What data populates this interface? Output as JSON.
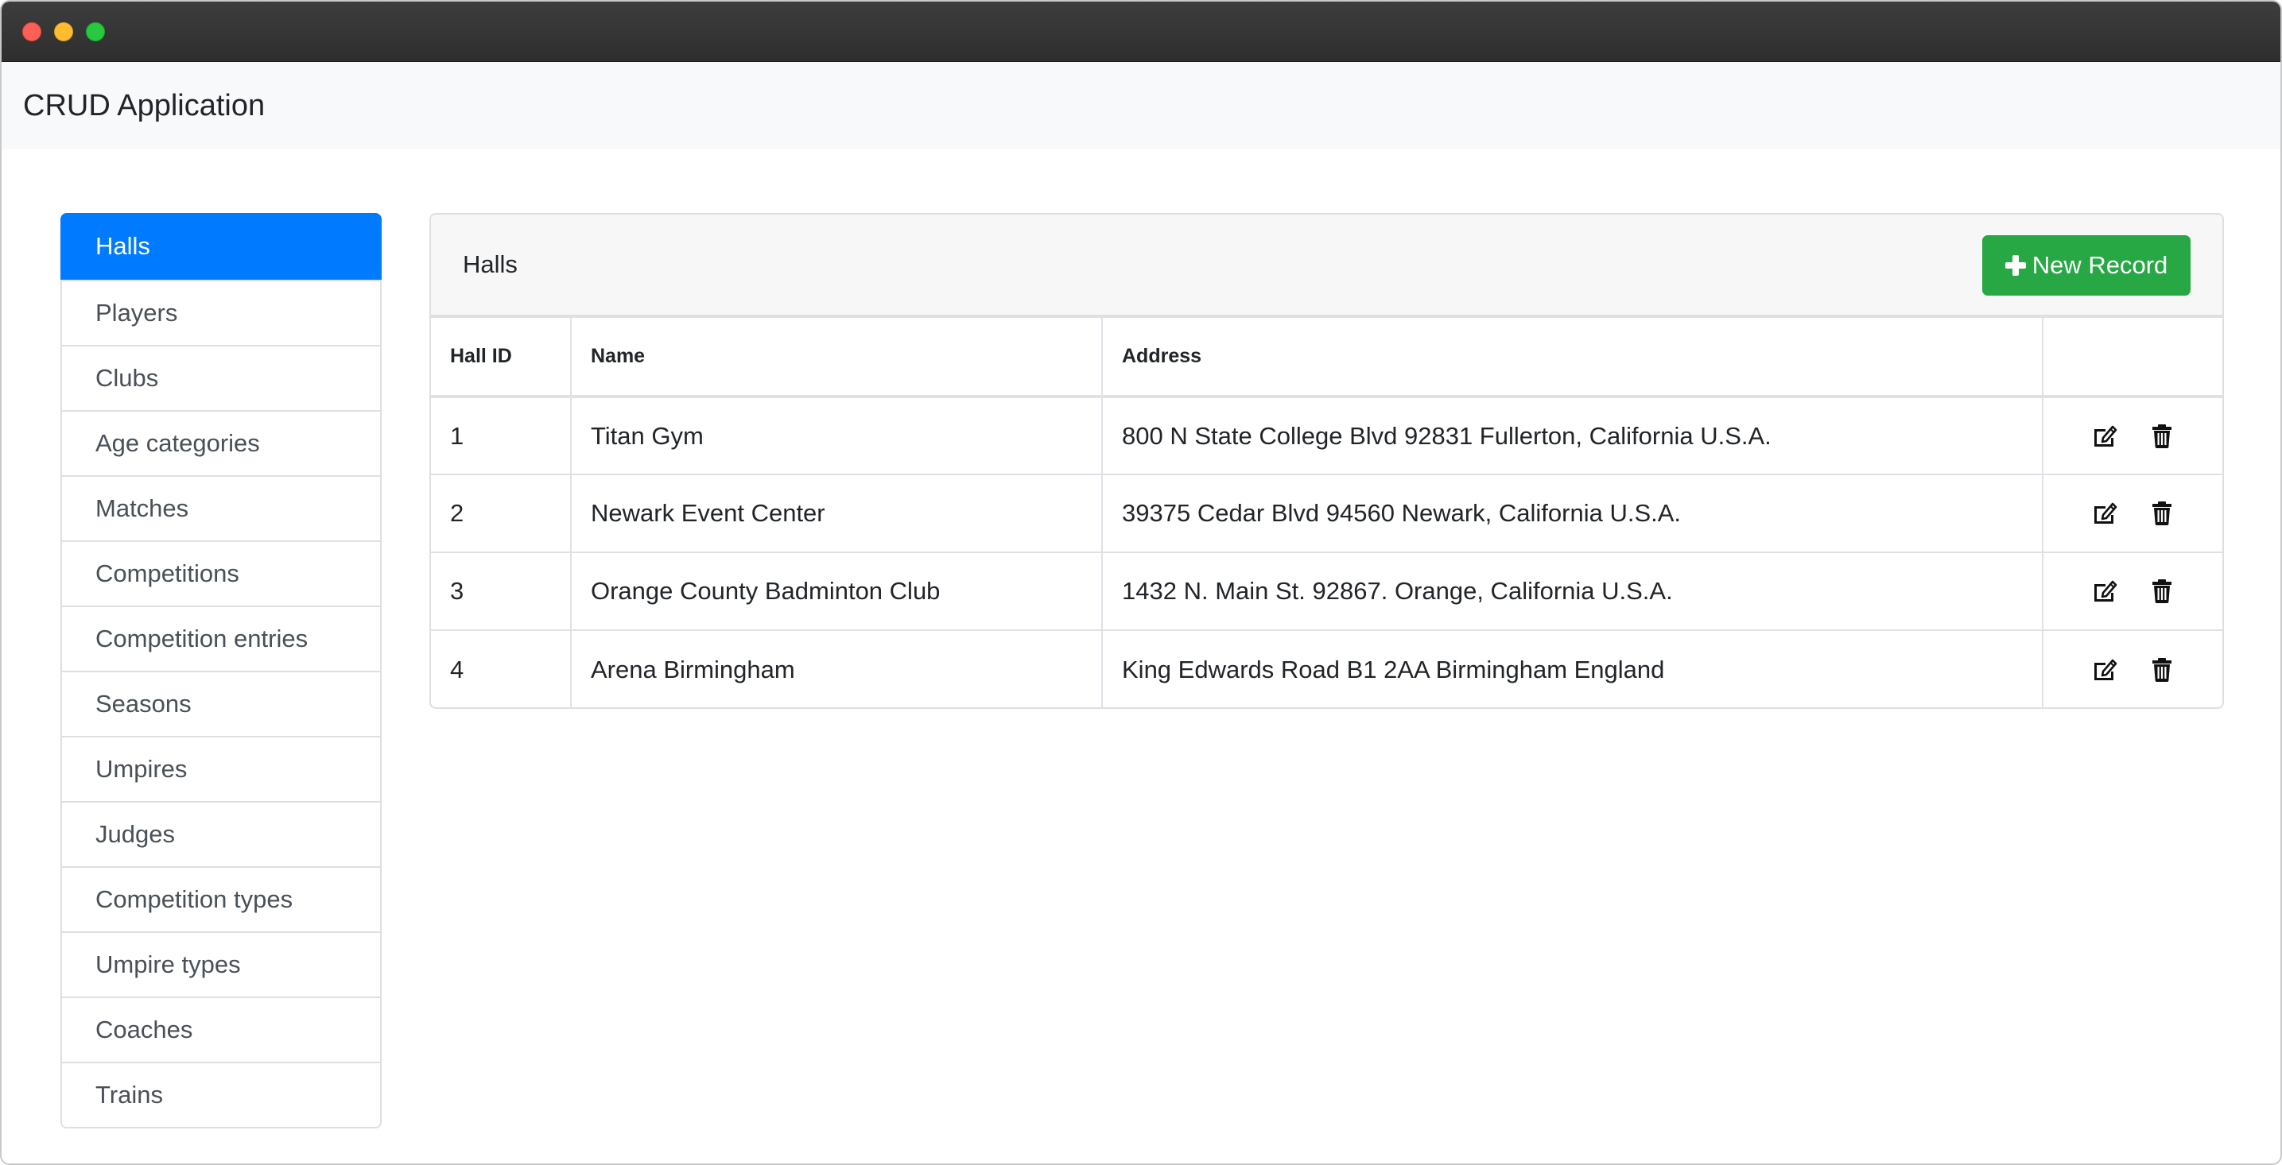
{
  "app": {
    "title": "CRUD Application"
  },
  "sidebar": {
    "items": [
      {
        "label": "Halls",
        "active": true
      },
      {
        "label": "Players"
      },
      {
        "label": "Clubs"
      },
      {
        "label": "Age categories"
      },
      {
        "label": "Matches"
      },
      {
        "label": "Competitions"
      },
      {
        "label": "Competition entries"
      },
      {
        "label": "Seasons"
      },
      {
        "label": "Umpires"
      },
      {
        "label": "Judges"
      },
      {
        "label": "Competition types"
      },
      {
        "label": "Umpire types"
      },
      {
        "label": "Coaches"
      },
      {
        "label": "Trains"
      }
    ]
  },
  "main": {
    "card_title": "Halls",
    "new_button_label": "New Record",
    "new_button_icon": "plus-icon",
    "columns": [
      "Hall ID",
      "Name",
      "Address",
      ""
    ],
    "rows": [
      {
        "id": "1",
        "name": "Titan Gym",
        "address": "800 N State College Blvd 92831 Fullerton, California U.S.A."
      },
      {
        "id": "2",
        "name": "Newark Event Center",
        "address": "39375 Cedar Blvd 94560 Newark, California U.S.A."
      },
      {
        "id": "3",
        "name": "Orange County Badminton Club",
        "address": "1432 N. Main St. 92867. Orange, California U.S.A."
      },
      {
        "id": "4",
        "name": "Arena Birmingham",
        "address": "King Edwards Road B1 2AA Birmingham England"
      }
    ],
    "row_action_icons": [
      "edit-icon",
      "trash-icon"
    ]
  },
  "colors": {
    "primary": "#007bff",
    "success": "#28a745",
    "navbar_bg": "#f8f9fa",
    "card_header_bg": "#f7f7f7"
  }
}
